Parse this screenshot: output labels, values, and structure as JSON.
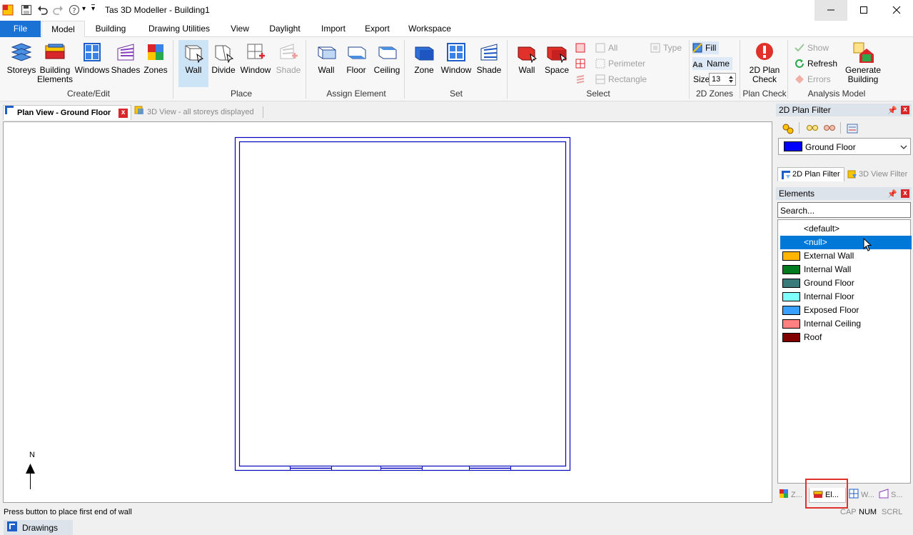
{
  "window": {
    "title": "Tas 3D Modeller - Building1",
    "minimize_icon": "minimize-icon",
    "maximize_icon": "maximize-icon",
    "close_icon": "close-icon"
  },
  "quick_access": {
    "dropdown_glyph": "▾",
    "customize_glyph": "▾"
  },
  "ribbon_tabs": [
    "File",
    "Model",
    "Building",
    "Drawing Utilities",
    "View",
    "Daylight",
    "Import",
    "Export",
    "Workspace"
  ],
  "ribbon": {
    "create_edit": {
      "label": "Create/Edit",
      "storeys": "Storeys",
      "building_elements_1": "Building",
      "building_elements_2": "Elements",
      "windows": "Windows",
      "shades": "Shades",
      "zones": "Zones"
    },
    "place": {
      "label": "Place",
      "wall": "Wall",
      "divide": "Divide",
      "window": "Window",
      "shade": "Shade"
    },
    "assign": {
      "label": "Assign Element",
      "wall": "Wall",
      "floor": "Floor",
      "ceiling": "Ceiling"
    },
    "set": {
      "label": "Set",
      "zone": "Zone",
      "window": "Window",
      "shade": "Shade"
    },
    "select": {
      "label": "Select",
      "wall": "Wall",
      "space": "Space",
      "all": "All",
      "perimeter": "Perimeter",
      "rectangle": "Rectangle",
      "type": "Type"
    },
    "zones2d": {
      "label": "2D Zones",
      "fill": "Fill",
      "name": "Name",
      "size_label": "Size",
      "size_value": "13"
    },
    "plan_check": {
      "label": "Plan Check",
      "btn_1": "2D Plan",
      "btn_2": "Check"
    },
    "analysis": {
      "label": "Analysis Model",
      "show": "Show",
      "refresh": "Refresh",
      "errors": "Errors",
      "generate_1": "Generate",
      "generate_2": "Building"
    }
  },
  "doc_tabs": {
    "plan_view": "Plan View - Ground Floor",
    "close_glyph": "x",
    "view_3d": "3D View - all storeys displayed"
  },
  "canvas": {
    "north": "N"
  },
  "plan_filter": {
    "title": "2D Plan Filter",
    "selected_storey": "Ground Floor",
    "storey_color": "#0000ff",
    "tab_2d": "2D Plan Filter",
    "tab_3d": "3D View Filter"
  },
  "elements_panel": {
    "title": "Elements",
    "search_value": "Search...",
    "items": [
      {
        "label": "<default>",
        "color": ""
      },
      {
        "label": "<null>",
        "color": "",
        "selected": true
      },
      {
        "label": "External Wall",
        "color": "#ffb400"
      },
      {
        "label": "Internal Wall",
        "color": "#007a1f"
      },
      {
        "label": "Ground Floor",
        "color": "#3a7a7a"
      },
      {
        "label": "Internal Floor",
        "color": "#80ffff"
      },
      {
        "label": "Exposed Floor",
        "color": "#3aa0ff"
      },
      {
        "label": "Internal Ceiling",
        "color": "#ff8080"
      },
      {
        "label": "Roof",
        "color": "#800000"
      }
    ],
    "bottom_tabs": [
      "Z...",
      "El...",
      "W...",
      "S..."
    ]
  },
  "status": {
    "message": "Press button to place first end of wall",
    "cap": "CAP",
    "num": "NUM",
    "scrl": "SCRL"
  },
  "bottom": {
    "drawings": "Drawings"
  },
  "colors": {
    "accent": "#1a73d4",
    "plan_lines": "#0000c0",
    "selection": "#0078d7",
    "highlight_box": "#e0312a"
  }
}
